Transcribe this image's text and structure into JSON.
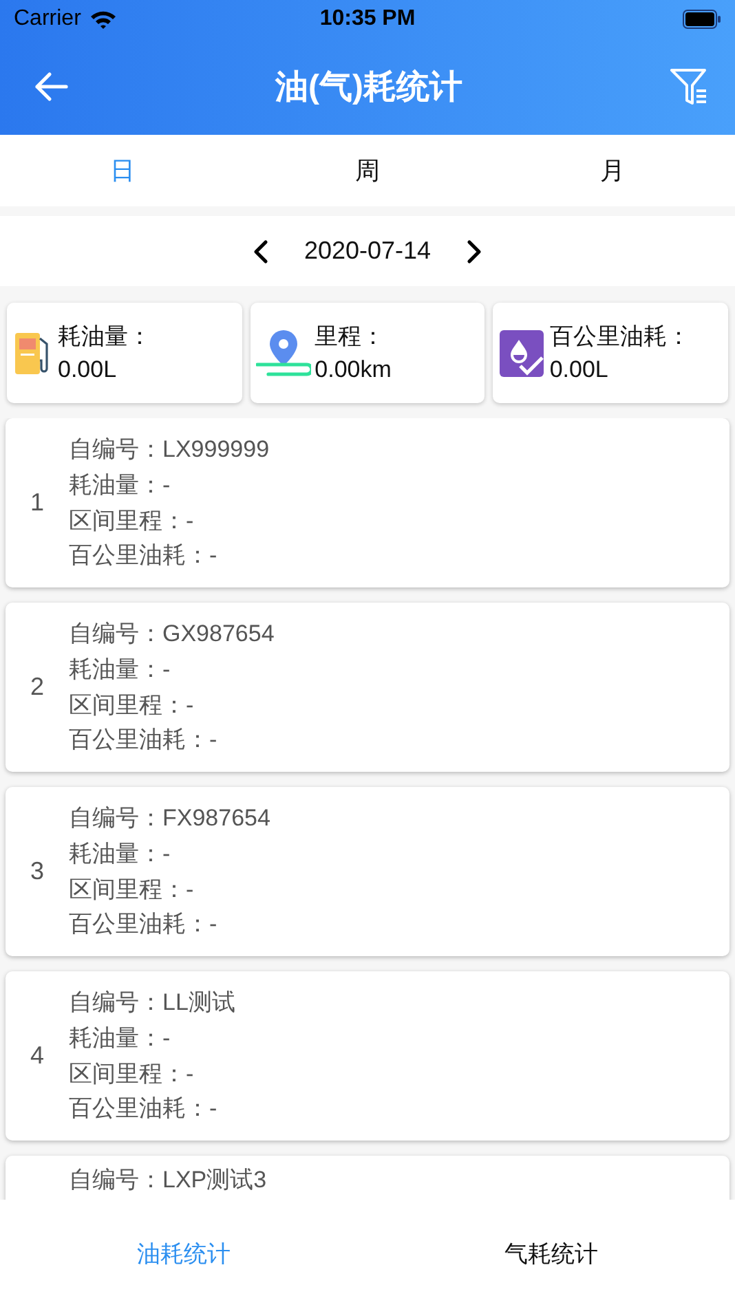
{
  "status_bar": {
    "carrier": "Carrier",
    "time": "10:35 PM"
  },
  "header": {
    "title": "油(气)耗统计"
  },
  "period_tabs": [
    {
      "label": "日",
      "selected": true
    },
    {
      "label": "周",
      "selected": false
    },
    {
      "label": "月",
      "selected": false
    }
  ],
  "date": "2020-07-14",
  "summary": [
    {
      "kind": "fuel",
      "label": "耗油量：",
      "value": "0.00L"
    },
    {
      "kind": "distance",
      "label": "里程：",
      "value": "0.00km"
    },
    {
      "kind": "rate",
      "label": "百公里油耗：",
      "value": "0.00L"
    }
  ],
  "records": [
    {
      "index": "1",
      "lines": [
        "自编号：LX999999",
        "耗油量：-",
        "区间里程：-",
        "百公里油耗：-"
      ]
    },
    {
      "index": "2",
      "lines": [
        "自编号：GX987654",
        "耗油量：-",
        "区间里程：-",
        "百公里油耗：-"
      ]
    },
    {
      "index": "3",
      "lines": [
        "自编号：FX987654",
        "耗油量：-",
        "区间里程：-",
        "百公里油耗：-"
      ]
    },
    {
      "index": "4",
      "lines": [
        "自编号：LL测试",
        "耗油量：-",
        "区间里程：-",
        "百公里油耗：-"
      ]
    },
    {
      "lines": [
        "自编号：LXP测试3"
      ]
    }
  ],
  "bottom_tabs": [
    {
      "label": "油耗统计",
      "selected": true
    },
    {
      "label": "气耗统计",
      "selected": false
    }
  ]
}
